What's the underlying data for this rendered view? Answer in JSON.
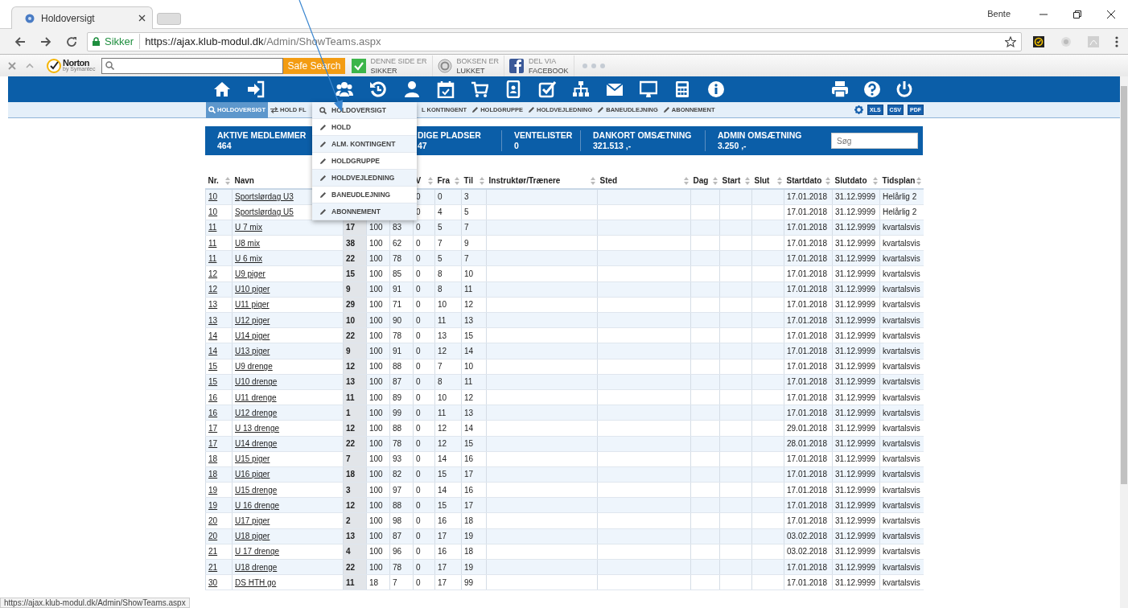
{
  "browser": {
    "tab_title": "Holdoversigt",
    "profile": "Bente",
    "security_label": "Sikker",
    "url_host": "https://ajax.klub-modul.dk",
    "url_path": "/Admin/ShowTeams.aspx"
  },
  "norton_bar": {
    "logo": "Norton",
    "logo_sub": "by Symantec",
    "search_button": "Safe Search",
    "badges": [
      {
        "kind": "check",
        "line1": "DENNE SIDE ER",
        "line2": "SIKKER"
      },
      {
        "kind": "ring",
        "line1": "BOKSEN ER",
        "line2": "LUKKET"
      },
      {
        "kind": "facebook",
        "line1": "DEL VIA",
        "line2": "FACEBOOK"
      }
    ]
  },
  "subnav": {
    "items": [
      {
        "kind": "search",
        "label": "HOLDOVERSIGT",
        "selected": true
      },
      {
        "kind": "swap",
        "label": "HOLD FL",
        "selected": false
      },
      {
        "kind": "hidden",
        "label": "L KONTINGENT",
        "selected": false
      },
      {
        "kind": "edit",
        "label": "HOLDGRUPPE",
        "selected": false
      },
      {
        "kind": "edit",
        "label": "HOLDVEJLEDNING",
        "selected": false
      },
      {
        "kind": "edit",
        "label": "BANEUDLEJNING",
        "selected": false
      },
      {
        "kind": "edit",
        "label": "ABONNEMENT",
        "selected": false
      }
    ],
    "exports": [
      "XLS",
      "CSV",
      "PDF"
    ]
  },
  "dropdown": {
    "items": [
      {
        "kind": "search",
        "label": "HOLDOVERSIGT"
      },
      {
        "kind": "edit",
        "label": "HOLD"
      },
      {
        "kind": "edit",
        "label": "ALM. KONTINGENT"
      },
      {
        "kind": "edit",
        "label": "HOLDGRUPPE"
      },
      {
        "kind": "edit",
        "label": "HOLDVEJLEDNING"
      },
      {
        "kind": "edit",
        "label": "BANEUDLEJNING"
      },
      {
        "kind": "edit",
        "label": "ABONNEMENT"
      }
    ]
  },
  "stats": [
    {
      "label": "AKTIVE MEDLEMMER",
      "value": "464"
    },
    {
      "label": "DIGE PLADSER",
      "value": "47"
    },
    {
      "label": "VENTELISTER",
      "value": "0"
    },
    {
      "label": "DANKORT OMSÆTNING",
      "value": "321.513 ,-"
    },
    {
      "label": "ADMIN OMSÆTNING",
      "value": "3.250 ,-"
    }
  ],
  "search": {
    "placeholder": "Søg"
  },
  "table": {
    "columns": [
      "Nr.",
      "Navn",
      null,
      null,
      null,
      "V",
      "Fra",
      "Til",
      "Instruktør/Trænere",
      "Sted",
      "Dag",
      "Start",
      "Slut",
      "Startdato",
      "Slutdato",
      "Tidsplan"
    ],
    "rows": [
      {
        "nr": "10",
        "navn": "Sportslørdag U3",
        "v": "0",
        "fra": "0",
        "til": "3",
        "startdato": "17.01.2018",
        "slutdato": "31.12.9999",
        "tidsplan": "Helårlig 2"
      },
      {
        "nr": "10",
        "navn": "Sportslørdag U5",
        "v": "0",
        "fra": "4",
        "til": "5",
        "startdato": "17.01.2018",
        "slutdato": "31.12.9999",
        "tidsplan": "Helårlig 2"
      },
      {
        "nr": "11",
        "navn": "U 7 mix",
        "column_3": "17",
        "column_4": "100",
        "column_5": "83",
        "v": "0",
        "fra": "5",
        "til": "7",
        "startdato": "17.01.2018",
        "slutdato": "31.12.9999",
        "tidsplan": "kvartalsvis"
      },
      {
        "nr": "11",
        "navn": "U8 mix",
        "column_3": "38",
        "column_4": "100",
        "column_5": "62",
        "v": "0",
        "fra": "7",
        "til": "9",
        "startdato": "17.01.2018",
        "slutdato": "31.12.9999",
        "tidsplan": "kvartalsvis"
      },
      {
        "nr": "11",
        "navn": "U 6 mix",
        "column_3": "22",
        "column_4": "100",
        "column_5": "78",
        "v": "0",
        "fra": "5",
        "til": "7",
        "startdato": "17.01.2018",
        "slutdato": "31.12.9999",
        "tidsplan": "kvartalsvis"
      },
      {
        "nr": "12",
        "navn": "U9 piger",
        "column_3": "15",
        "column_4": "100",
        "column_5": "85",
        "v": "0",
        "fra": "8",
        "til": "10",
        "startdato": "17.01.2018",
        "slutdato": "31.12.9999",
        "tidsplan": "kvartalsvis"
      },
      {
        "nr": "12",
        "navn": "U10 piger",
        "column_3": "9",
        "column_4": "100",
        "column_5": "91",
        "v": "0",
        "fra": "8",
        "til": "11",
        "startdato": "17.01.2018",
        "slutdato": "31.12.9999",
        "tidsplan": "kvartalsvis"
      },
      {
        "nr": "13",
        "navn": "U11 piger",
        "column_3": "29",
        "column_4": "100",
        "column_5": "71",
        "v": "0",
        "fra": "10",
        "til": "12",
        "startdato": "17.01.2018",
        "slutdato": "31.12.9999",
        "tidsplan": "kvartalsvis"
      },
      {
        "nr": "13",
        "navn": "U12 piger",
        "column_3": "10",
        "column_4": "100",
        "column_5": "90",
        "v": "0",
        "fra": "11",
        "til": "13",
        "startdato": "17.01.2018",
        "slutdato": "31.12.9999",
        "tidsplan": "kvartalsvis"
      },
      {
        "nr": "14",
        "navn": "U14 piger",
        "column_3": "22",
        "column_4": "100",
        "column_5": "78",
        "v": "0",
        "fra": "13",
        "til": "15",
        "startdato": "17.01.2018",
        "slutdato": "31.12.9999",
        "tidsplan": "kvartalsvis"
      },
      {
        "nr": "14",
        "navn": "U13 piger",
        "column_3": "9",
        "column_4": "100",
        "column_5": "91",
        "v": "0",
        "fra": "12",
        "til": "14",
        "startdato": "17.01.2018",
        "slutdato": "31.12.9999",
        "tidsplan": "kvartalsvis"
      },
      {
        "nr": "15",
        "navn": "U9 drenge",
        "column_3": "12",
        "column_4": "100",
        "column_5": "88",
        "v": "0",
        "fra": "7",
        "til": "10",
        "startdato": "17.01.2018",
        "slutdato": "31.12.9999",
        "tidsplan": "kvartalsvis"
      },
      {
        "nr": "15",
        "navn": "U10 drenge",
        "column_3": "13",
        "column_4": "100",
        "column_5": "87",
        "v": "0",
        "fra": "8",
        "til": "11",
        "startdato": "17.01.2018",
        "slutdato": "31.12.9999",
        "tidsplan": "kvartalsvis"
      },
      {
        "nr": "16",
        "navn": "U11 drenge",
        "column_3": "11",
        "column_4": "100",
        "column_5": "89",
        "v": "0",
        "fra": "10",
        "til": "12",
        "startdato": "17.01.2018",
        "slutdato": "31.12.9999",
        "tidsplan": "kvartalsvis"
      },
      {
        "nr": "16",
        "navn": "U12 drenge",
        "column_3": "1",
        "column_4": "100",
        "column_5": "99",
        "v": "0",
        "fra": "11",
        "til": "13",
        "startdato": "17.01.2018",
        "slutdato": "31.12.9999",
        "tidsplan": "kvartalsvis"
      },
      {
        "nr": "17",
        "navn": "U 13 drenge",
        "column_3": "12",
        "column_4": "100",
        "column_5": "88",
        "v": "0",
        "fra": "12",
        "til": "14",
        "startdato": "29.01.2018",
        "slutdato": "31.12.9999",
        "tidsplan": "kvartalsvis"
      },
      {
        "nr": "17",
        "navn": "U14 drenge",
        "column_3": "22",
        "column_4": "100",
        "column_5": "78",
        "v": "0",
        "fra": "12",
        "til": "15",
        "startdato": "28.01.2018",
        "slutdato": "31.12.9999",
        "tidsplan": "kvartalsvis"
      },
      {
        "nr": "18",
        "navn": "U15 piger",
        "column_3": "7",
        "column_4": "100",
        "column_5": "93",
        "v": "0",
        "fra": "14",
        "til": "16",
        "startdato": "17.01.2018",
        "slutdato": "31.12.9999",
        "tidsplan": "kvartalsvis"
      },
      {
        "nr": "18",
        "navn": "U16 piger",
        "column_3": "18",
        "column_4": "100",
        "column_5": "82",
        "v": "0",
        "fra": "15",
        "til": "17",
        "startdato": "17.01.2018",
        "slutdato": "31.12.9999",
        "tidsplan": "kvartalsvis"
      },
      {
        "nr": "19",
        "navn": "U15 drenge",
        "column_3": "3",
        "column_4": "100",
        "column_5": "97",
        "v": "0",
        "fra": "14",
        "til": "16",
        "startdato": "17.01.2018",
        "slutdato": "31.12.9999",
        "tidsplan": "kvartalsvis"
      },
      {
        "nr": "19",
        "navn": "U 16 drenge",
        "column_3": "12",
        "column_4": "100",
        "column_5": "88",
        "v": "0",
        "fra": "15",
        "til": "17",
        "startdato": "17.01.2018",
        "slutdato": "31.12.9999",
        "tidsplan": "kvartalsvis"
      },
      {
        "nr": "20",
        "navn": "U17 piger",
        "column_3": "2",
        "column_4": "100",
        "column_5": "98",
        "v": "0",
        "fra": "16",
        "til": "18",
        "startdato": "17.01.2018",
        "slutdato": "31.12.9999",
        "tidsplan": "kvartalsvis"
      },
      {
        "nr": "20",
        "navn": "U18 piger",
        "column_3": "13",
        "column_4": "100",
        "column_5": "87",
        "v": "0",
        "fra": "17",
        "til": "19",
        "startdato": "03.02.2018",
        "slutdato": "31.12.9999",
        "tidsplan": "kvartalsvis"
      },
      {
        "nr": "21",
        "navn": "U 17 drenge",
        "column_3": "4",
        "column_4": "100",
        "column_5": "96",
        "v": "0",
        "fra": "16",
        "til": "18",
        "startdato": "03.02.2018",
        "slutdato": "31.12.9999",
        "tidsplan": "kvartalsvis"
      },
      {
        "nr": "21",
        "navn": "U18 drenge",
        "column_3": "22",
        "column_4": "100",
        "column_5": "78",
        "v": "0",
        "fra": "17",
        "til": "19",
        "startdato": "17.01.2018",
        "slutdato": "31.12.9999",
        "tidsplan": "kvartalsvis"
      },
      {
        "nr": "30",
        "navn": "DS HTH go",
        "column_3": "11",
        "column_4": "18",
        "column_5": "7",
        "v": "0",
        "fra": "17",
        "til": "99",
        "startdato": "17.01.2018",
        "slutdato": "31.12.9999",
        "tidsplan": "kvartalsvis"
      }
    ]
  },
  "status_bar": "https://ajax.klub-modul.dk/Admin/ShowTeams.aspx"
}
